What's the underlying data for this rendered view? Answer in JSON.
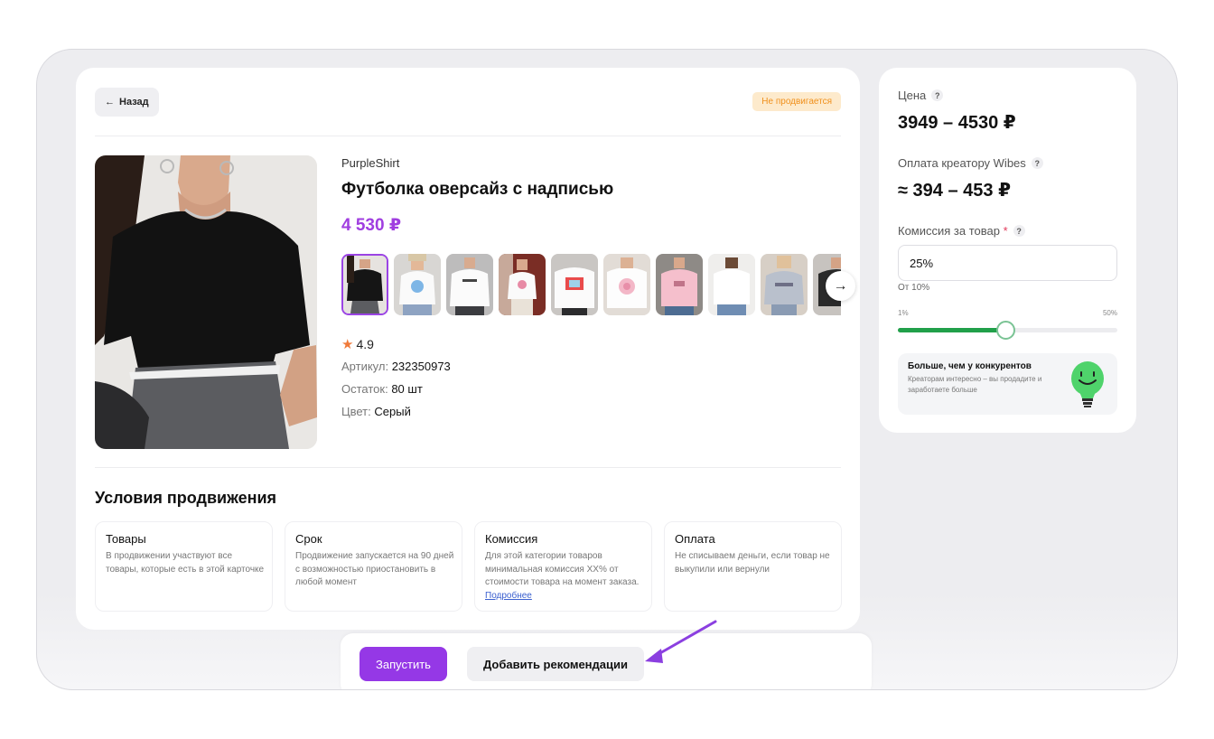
{
  "product": {
    "back_label": "Назад",
    "status_badge": "Не продвигается",
    "brand": "PurpleShirt",
    "title": "Футболка оверсайз с надписью",
    "price": "4 530 ₽",
    "rating": "4.9",
    "sku_label": "Артикул:",
    "sku_value": "232350973",
    "stock_label": "Остаток:",
    "stock_value": "80 шт",
    "color_label": "Цвет:",
    "color_value": "Серый",
    "thumbnail_count": 10,
    "active_thumbnail": 0
  },
  "conditions": {
    "title": "Условия продвижения",
    "items": [
      {
        "title": "Товары",
        "text": "В продвижении участвуют все товары, которые есть в этой карточке"
      },
      {
        "title": "Срок",
        "text": "Продвижение запускается на 90 дней с возможностью приостановить в любой момент"
      },
      {
        "title": "Комиссия",
        "text": "Для этой категории товаров минимальная комиссия XX% от стоимости товара на момент заказа.",
        "link": "Подробнее"
      },
      {
        "title": "Оплата",
        "text": "Не списываем деньги, если товар не выкупили или вернули"
      }
    ]
  },
  "actions": {
    "run_label": "Запустить",
    "recommendations_label": "Добавить рекомендации"
  },
  "sidebar": {
    "price_label": "Цена",
    "price_value": "3949 – 4530 ₽",
    "creator_pay_label": "Оплата креатору Wibes",
    "creator_pay_value": "≈ 394 – 453 ₽",
    "commission_label": "Комиссия за товар",
    "required_mark": "*",
    "help_mark": "?",
    "commission_value": "25%",
    "commission_hint": "От 10%",
    "slider_min_label": "1%",
    "slider_max_label": "50%",
    "slider_min": 1,
    "slider_max": 50,
    "slider_value": 25,
    "tip_title": "Больше, чем у конкурентов",
    "tip_text": "Креаторам интересно – вы продадите и заработаете больше"
  },
  "colors": {
    "accent": "#9538e6",
    "price": "#a03ee0",
    "slider_fill": "#21a04a",
    "badge_bg": "#fdeacc",
    "badge_text": "#f0901c",
    "arrow": "#8b3fe0",
    "lightbulb": "#4fd36b"
  },
  "icons": {
    "back": "arrow-left-icon",
    "next": "arrow-right-icon",
    "star": "star-icon",
    "help": "question-icon",
    "tip": "lightbulb-smile-icon"
  }
}
